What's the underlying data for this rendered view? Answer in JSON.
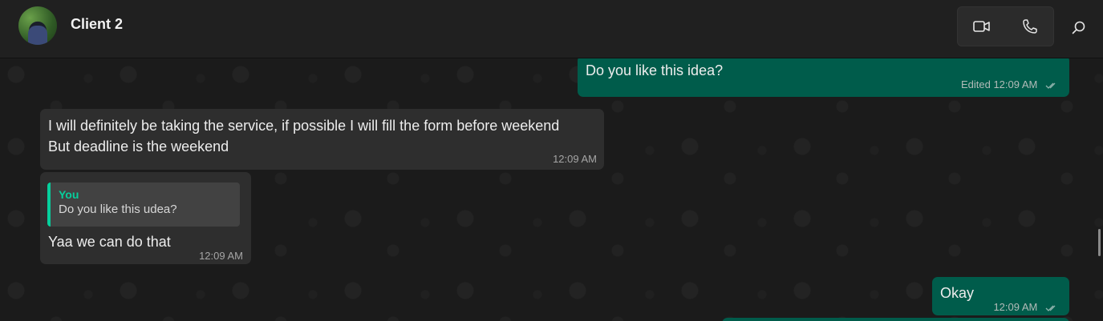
{
  "header": {
    "chat_name": "Client 2",
    "avatar_icon": "profile-photo",
    "video_icon": "video-camera-icon",
    "voice_icon": "phone-icon",
    "search_icon": "search-icon"
  },
  "messages": [
    {
      "direction": "out",
      "text": "Do you like this idea?",
      "meta": "Edited 12:09 AM",
      "status": "read"
    },
    {
      "direction": "in",
      "lines": [
        "I will definitely be taking the service, if possible I will fill the form before weekend",
        "But deadline is the weekend"
      ],
      "meta": "12:09 AM"
    },
    {
      "direction": "in",
      "quote": {
        "author": "You",
        "text": "Do you like this udea?"
      },
      "text": "Yaa we can do that",
      "meta": "12:09 AM"
    },
    {
      "direction": "out",
      "text": "Okay",
      "meta": "12:09 AM",
      "status": "read"
    }
  ],
  "colors": {
    "outgoing_bubble": "#005c4b",
    "incoming_bubble": "#2e2e2e",
    "accent": "#06cf9c",
    "header_bg": "#202020"
  }
}
